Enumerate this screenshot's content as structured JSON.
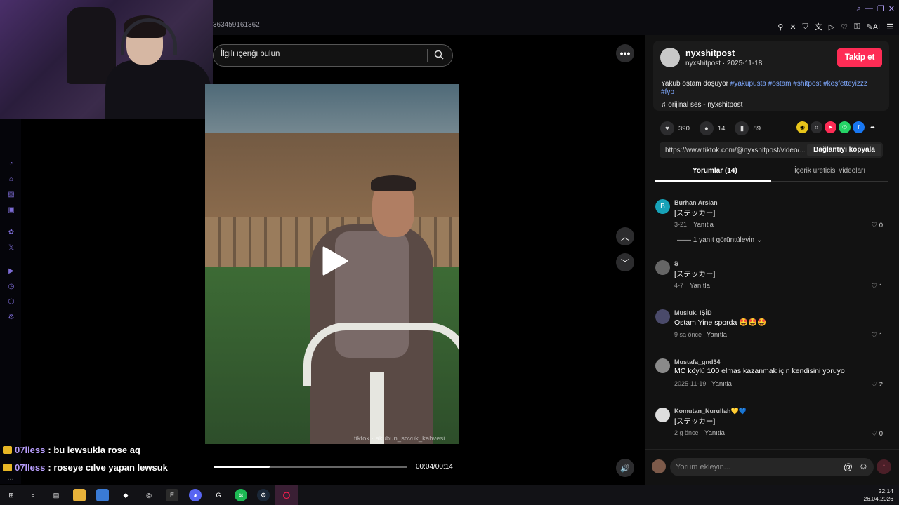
{
  "browser": {
    "url_fragment": "363459161362",
    "extensions": [
      "pin-icon",
      "close-icon",
      "shield-icon",
      "translate-icon",
      "play-icon",
      "heart-icon",
      "lock-icon",
      "ai-icon",
      "menu-icon"
    ],
    "ai_label": "AI"
  },
  "stream_chat": [
    {
      "user": "07lless",
      "message": " : bu lewsukla rose aq"
    },
    {
      "user": "07lless",
      "message": " : roseye cılve yapan lewsuk"
    }
  ],
  "search": {
    "placeholder": "İlgili içeriği bulun"
  },
  "video": {
    "watermark": "tiktok · akubun_sovuk_kahvesi",
    "time": "00:04/00:14",
    "progress": 0.29
  },
  "post": {
    "author": "nyxshitpost",
    "meta": "nyxshitpost · 2025-11-18",
    "follow_label": "Takip et",
    "caption_text": "Yakub ostam döşüyor ",
    "hashtags": [
      "#yakupusta",
      "#ostam",
      "#shitpost",
      "#keşfetteyizzz",
      "#fyp"
    ],
    "sound": "orijinal ses - nyxshitpost",
    "likes": "390",
    "comments_count": "14",
    "saves": "89",
    "link": "https://www.tiktok.com/@nyxshitpost/video/...",
    "copy_label": "Bağlantıyı kopyala"
  },
  "tabs": [
    {
      "label": "Yorumlar (14)",
      "active": true
    },
    {
      "label": "İçerik üreticisi videoları",
      "active": false
    }
  ],
  "comments": [
    {
      "user": "Burhan Arslan",
      "initial": "B",
      "text": "[ステッカー]",
      "date": "3-21",
      "reply": "Yanıtla",
      "likes": "0",
      "avatar_color": "#17a2b8"
    },
    {
      "user": "𝕴",
      "initial": "",
      "text": "[ステッカー]",
      "date": "4-7",
      "reply": "Yanıtla",
      "likes": "1",
      "avatar_color": "#666666"
    },
    {
      "user": "Musluk, IŞİD",
      "initial": "",
      "text": "Ostam Yine sporda 🤩🤩🤩",
      "date": "9 sa önce",
      "reply": "Yanıtla",
      "likes": "1",
      "avatar_color": "#4a4a6a"
    },
    {
      "user": "Mustafa_gnd34",
      "initial": "",
      "text": "MC köylü 100 elmas kazanmak için kendisini yoruyo",
      "date": "2025-11-19",
      "reply": "Yanıtla",
      "likes": "2",
      "avatar_color": "#8a8a8a"
    },
    {
      "user": "Komutan_Nurullah💛💙",
      "initial": "",
      "text": "[ステッカー]",
      "date": "2 g önce",
      "reply": "Yanıtla",
      "likes": "0",
      "avatar_color": "#dddddd"
    }
  ],
  "view_replies": "1 yanıt görüntüleyin",
  "comment_box": {
    "placeholder": "Yorum ekleyin..."
  },
  "clock": {
    "time": "22:14",
    "date": "26.04.2026"
  },
  "colors": {
    "accent": "#fe2c55",
    "hashtag": "#7fa9ff",
    "sidebar_icon": "#7c6bd4"
  }
}
